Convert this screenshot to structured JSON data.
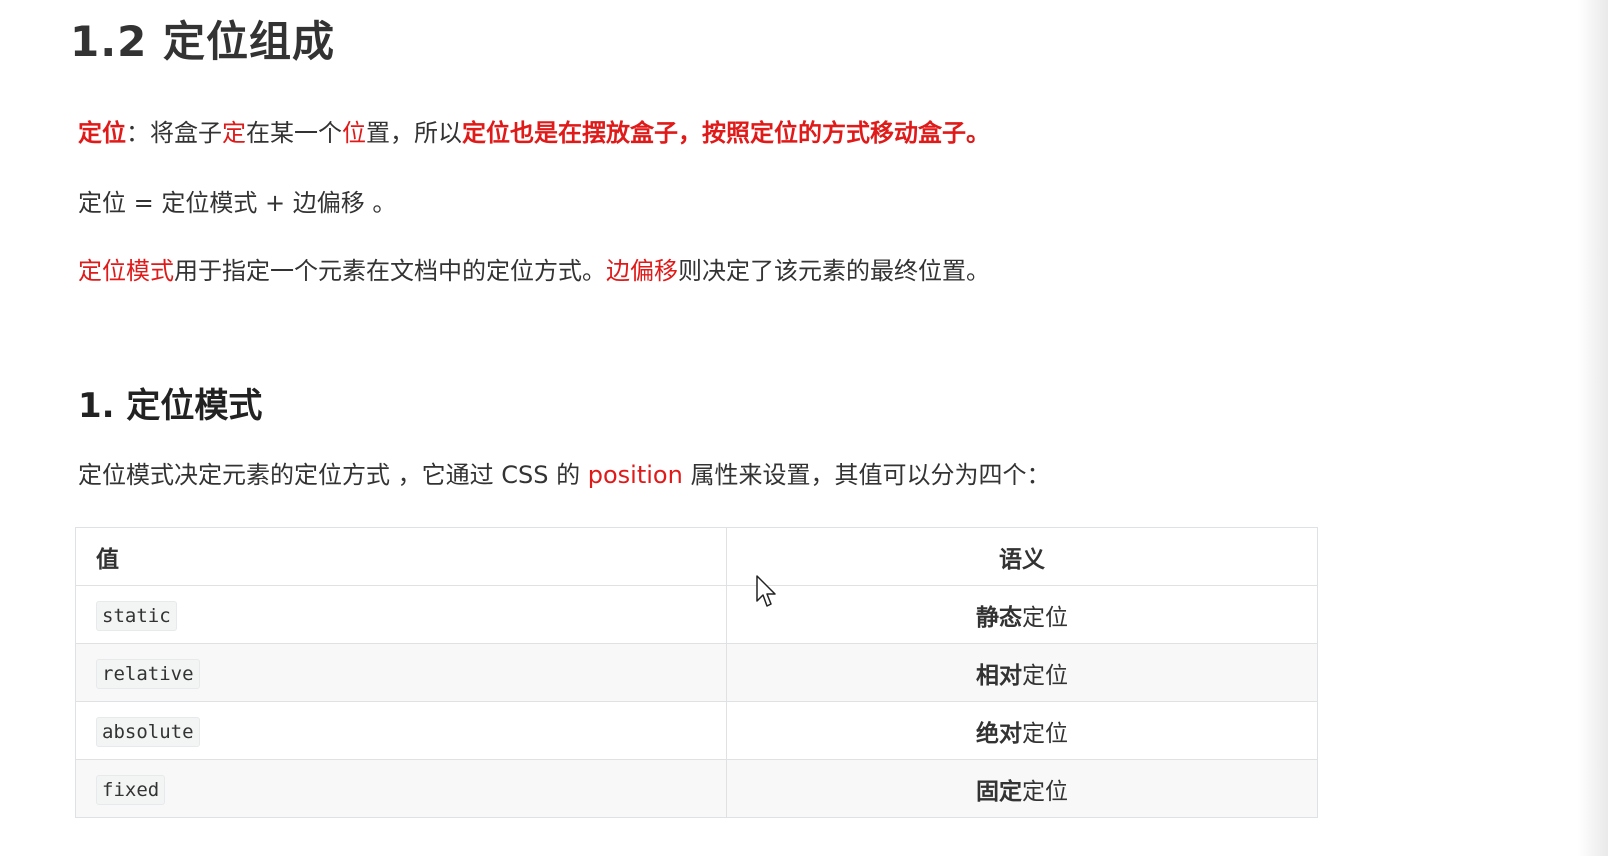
{
  "heading": "1.2 定位组成",
  "para1": {
    "t1": "定位",
    "t2": "：将盒子",
    "t3": "定",
    "t4": "在某一个",
    "t5": "位",
    "t6": "置，所以",
    "t7": "定位也是在摆放盒子，按照定位的方式移动盒子。"
  },
  "para2": "定位 = 定位模式 + 边偏移 。",
  "para3": {
    "t1": "定位模式",
    "t2": "用于指定一个元素在文档中的定位方式。",
    "t3": "边偏移",
    "t4": "则决定了该元素的最终位置。"
  },
  "subheading": "1. 定位模式",
  "para4": {
    "t1": "定位模式决定元素的定位方式 ，它通过 CSS 的 ",
    "t2": "position",
    "t3": " 属性来设置，其值可以分为四个："
  },
  "table": {
    "headers": [
      "值",
      "语义"
    ],
    "rows": [
      {
        "value": "static",
        "bold": "静态",
        "rest": "定位"
      },
      {
        "value": "relative",
        "bold": "相对",
        "rest": "定位"
      },
      {
        "value": "absolute",
        "bold": "绝对",
        "rest": "定位"
      },
      {
        "value": "fixed",
        "bold": "固定",
        "rest": "定位"
      }
    ]
  },
  "colors": {
    "accent_red": "#e01919",
    "text": "#333333",
    "table_border": "#dfe2e5"
  },
  "icons": {
    "cursor": "mouse-pointer-icon"
  }
}
